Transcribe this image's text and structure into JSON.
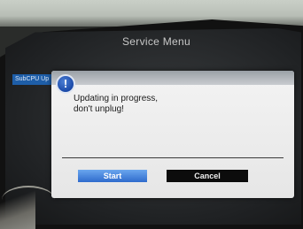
{
  "service_menu": {
    "title": "Service Menu",
    "sidebar_item": "SubCPU Up"
  },
  "dialog": {
    "icon": "exclamation-info-icon",
    "message_line1": "Updating in progress,",
    "message_line2": "don't unplug!",
    "start_label": "Start",
    "cancel_label": "Cancel"
  },
  "colors": {
    "accent_blue": "#2f6bcc",
    "dialog_bg": "#eeeeee",
    "cancel_bg": "#0c0c0c"
  }
}
